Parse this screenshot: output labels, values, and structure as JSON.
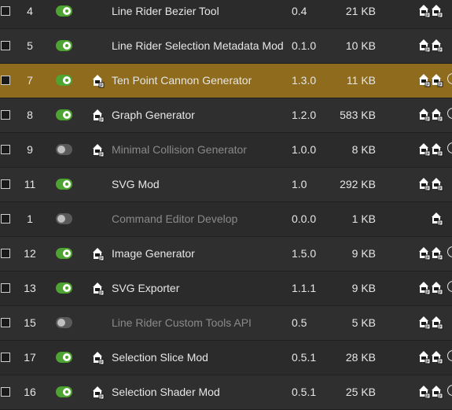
{
  "mods": [
    {
      "num": "4",
      "name": "Line Rider Bezier Tool",
      "version": "0.4",
      "size": "21 KB",
      "enabled": true,
      "has_icon": false,
      "actions": [
        "download-icon",
        "download-icon"
      ],
      "clock": false,
      "selected": false
    },
    {
      "num": "5",
      "name": "Line Rider Selection Metadata Mod",
      "version": "0.1.0",
      "size": "10 KB",
      "enabled": true,
      "has_icon": false,
      "actions": [
        "download-icon",
        "download-icon"
      ],
      "clock": false,
      "selected": false
    },
    {
      "num": "7",
      "name": "Ten Point Cannon Generator",
      "version": "1.3.0",
      "size": "11 KB",
      "enabled": true,
      "has_icon": true,
      "actions": [
        "download-icon",
        "download-icon"
      ],
      "clock": true,
      "selected": true
    },
    {
      "num": "8",
      "name": "Graph Generator",
      "version": "1.2.0",
      "size": "583 KB",
      "enabled": true,
      "has_icon": true,
      "actions": [
        "download-icon",
        "download-icon"
      ],
      "clock": true,
      "selected": false
    },
    {
      "num": "9",
      "name": "Minimal Collision Generator",
      "version": "1.0.0",
      "size": "8 KB",
      "enabled": false,
      "has_icon": true,
      "actions": [
        "download-icon",
        "download-icon"
      ],
      "clock": true,
      "selected": false
    },
    {
      "num": "11",
      "name": "SVG Mod",
      "version": "1.0",
      "size": "292 KB",
      "enabled": true,
      "has_icon": false,
      "actions": [
        "download-icon",
        "download-icon"
      ],
      "clock": false,
      "selected": false
    },
    {
      "num": "1",
      "name": "Command Editor Develop",
      "version": "0.0.0",
      "size": "1 KB",
      "enabled": false,
      "has_icon": false,
      "actions": [
        "download-icon"
      ],
      "clock": false,
      "selected": false
    },
    {
      "num": "12",
      "name": "Image Generator",
      "version": "1.5.0",
      "size": "9 KB",
      "enabled": true,
      "has_icon": true,
      "actions": [
        "download-icon",
        "download-icon"
      ],
      "clock": true,
      "selected": false
    },
    {
      "num": "13",
      "name": "SVG Exporter",
      "version": "1.1.1",
      "size": "9 KB",
      "enabled": true,
      "has_icon": true,
      "actions": [
        "download-icon",
        "download-icon"
      ],
      "clock": true,
      "selected": false
    },
    {
      "num": "15",
      "name": "Line Rider Custom Tools API",
      "version": "0.5",
      "size": "5 KB",
      "enabled": false,
      "has_icon": false,
      "actions": [
        "download-icon",
        "download-icon"
      ],
      "clock": false,
      "selected": false
    },
    {
      "num": "17",
      "name": "Selection Slice Mod",
      "version": "0.5.1",
      "size": "28 KB",
      "enabled": true,
      "has_icon": true,
      "actions": [
        "download-icon",
        "download-icon"
      ],
      "clock": true,
      "selected": false
    },
    {
      "num": "16",
      "name": "Selection Shader Mod",
      "version": "0.5.1",
      "size": "25 KB",
      "enabled": true,
      "has_icon": true,
      "actions": [
        "download-icon",
        "download-icon"
      ],
      "clock": true,
      "selected": false
    }
  ],
  "colors": {
    "background": "#2b2b2b",
    "selected_row": "#8e6b1d",
    "toggle_on": "#4ea430",
    "toggle_off": "#5a5a5a",
    "disabled_text": "#8a8a8a"
  }
}
